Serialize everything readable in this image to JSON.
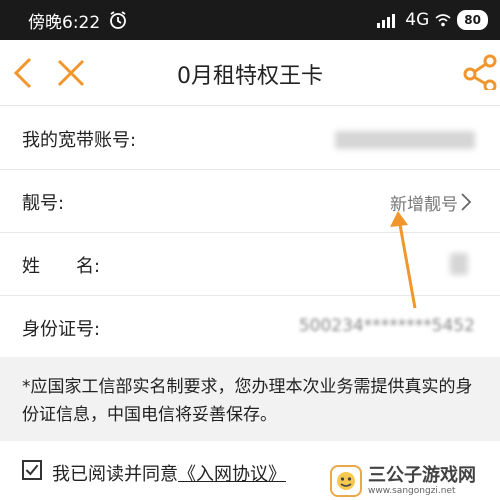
{
  "status_bar": {
    "time": "傍晚6:22",
    "network": "4G",
    "battery": "80"
  },
  "nav": {
    "title": "0月租特权王卡"
  },
  "form": {
    "rows": [
      {
        "label": "我的宽带账号:"
      },
      {
        "label": "靓号:",
        "value": "新增靓号"
      },
      {
        "label": "姓　　名:"
      },
      {
        "label": "身份证号:",
        "value": "500234********5452"
      }
    ]
  },
  "notice": {
    "text": "*应国家工信部实名制要求，您办理本次业务需提供真实的身份证信息，中国电信将妥善保存。"
  },
  "agreement": {
    "text": "我已阅读并同意",
    "link": "《入网协议》",
    "checked": true
  },
  "watermark": {
    "title": "三公子游戏网",
    "url": "www.sangongzi.net"
  },
  "colors": {
    "accent": "#f0962d",
    "status_bar_bg": "#1a1a1a",
    "notice_bg": "#f2f2f2"
  }
}
